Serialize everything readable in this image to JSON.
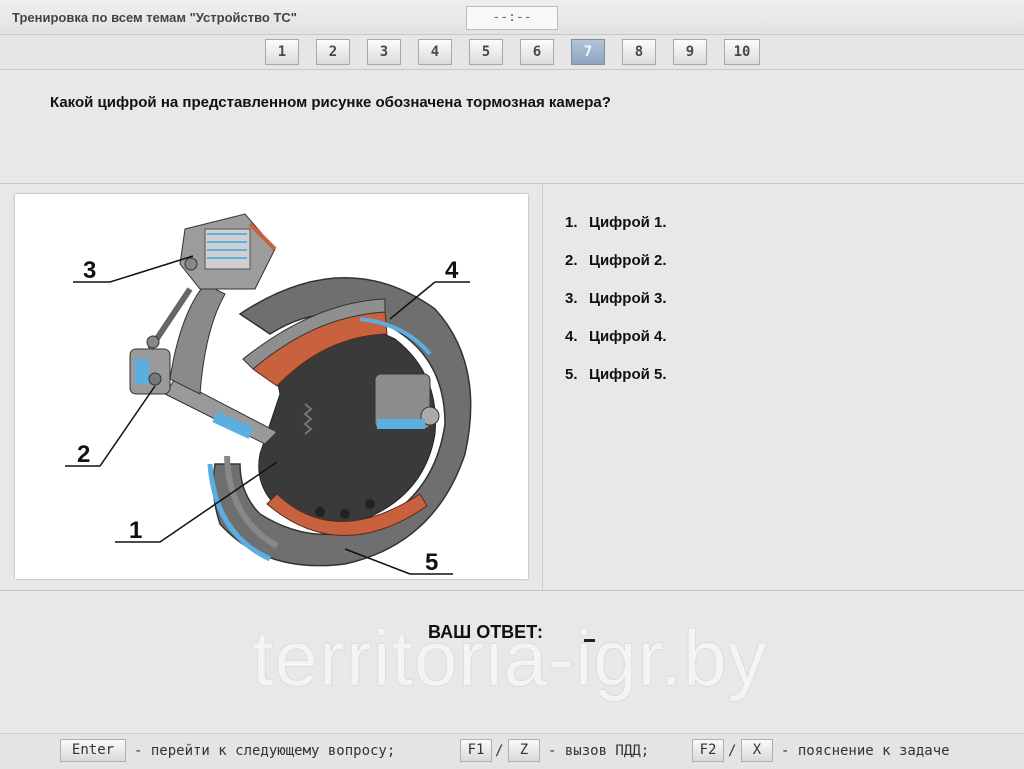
{
  "header": {
    "title": "Тренировка по всем темам \"Устройство ТС\"",
    "timer": "--:--"
  },
  "question_nav": {
    "numbers": [
      "1",
      "2",
      "3",
      "4",
      "5",
      "6",
      "7",
      "8",
      "9",
      "10"
    ],
    "active": "7"
  },
  "question": {
    "text": "Какой цифрой на представленном рисунке обозначена тормозная камера?"
  },
  "figure": {
    "labels": [
      "3",
      "4",
      "2",
      "1",
      "5"
    ]
  },
  "answers": [
    {
      "num": "1.",
      "text": "Цифрой 1."
    },
    {
      "num": "2.",
      "text": "Цифрой 2."
    },
    {
      "num": "3.",
      "text": "Цифрой 3."
    },
    {
      "num": "4.",
      "text": "Цифрой 4."
    },
    {
      "num": "5.",
      "text": "Цифрой 5."
    }
  ],
  "response": {
    "label": "ВАШ  ОТВЕТ:",
    "watermark": "territoria-igr.by"
  },
  "footer": {
    "enter_key": "Enter",
    "enter_text": "- перейти к следующему вопросу;",
    "f1_key": "F1",
    "z_key": "Z",
    "slash": "/",
    "pdd_text": "- вызов ПДД;",
    "f2_key": "F2",
    "x_key": "X",
    "explain_text": "- пояснение к задаче"
  },
  "colors": {
    "active_button": "#9fb2c8",
    "lining": "#c8623e",
    "metal": "#6f6f6f",
    "accent_blue": "#5aaee0"
  }
}
